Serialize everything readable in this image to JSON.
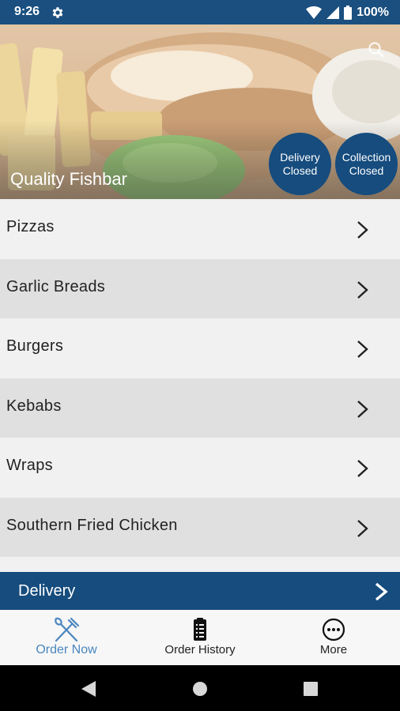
{
  "status_bar": {
    "time": "9:26",
    "battery": "100%",
    "icons": [
      "gear-icon",
      "wifi-icon",
      "signal-icon",
      "battery-icon"
    ]
  },
  "hero": {
    "restaurant_name": "Quality Fishbar",
    "delivery_status": {
      "line1": "Delivery",
      "line2": "Closed"
    },
    "collection_status": {
      "line1": "Collection",
      "line2": "Closed"
    }
  },
  "categories": [
    {
      "label": "Pizzas"
    },
    {
      "label": "Garlic Breads"
    },
    {
      "label": "Burgers"
    },
    {
      "label": "Kebabs"
    },
    {
      "label": "Wraps"
    },
    {
      "label": "Southern Fried Chicken"
    }
  ],
  "delivery_bar": {
    "label": "Delivery"
  },
  "bottom_nav": {
    "order_now": "Order Now",
    "order_history": "Order History",
    "more": "More"
  },
  "colors": {
    "brand": "#164c7e",
    "active_nav": "#4a86bf",
    "row_light": "#f1f1f1",
    "row_dark": "#e0e0e0"
  }
}
